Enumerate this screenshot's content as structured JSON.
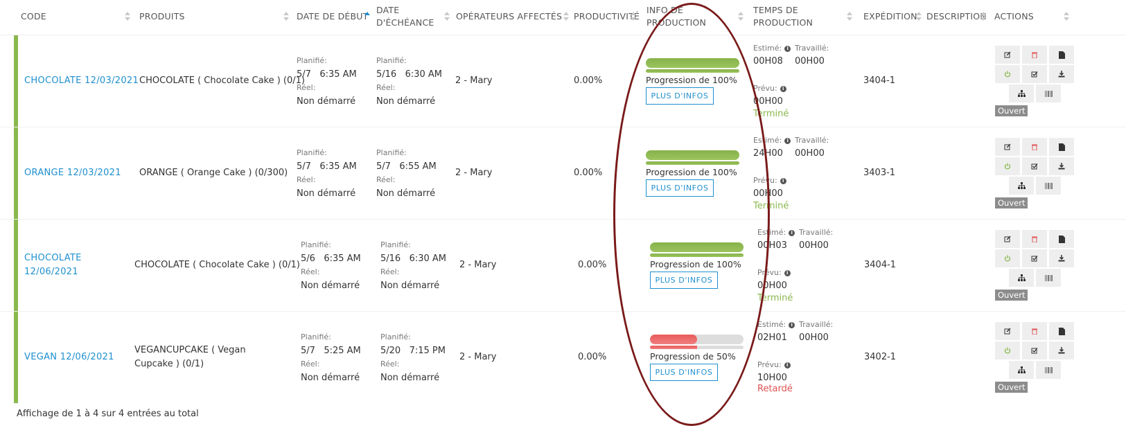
{
  "table": {
    "columns": [
      {
        "label": "CODE",
        "sort": "none"
      },
      {
        "label": "PRODUITS",
        "sort": "none"
      },
      {
        "label": "DATE DE DÉBUT",
        "sort": "asc"
      },
      {
        "label": "DATE D'ÉCHÉANCE",
        "sort": "none"
      },
      {
        "label": "OPÉRATEURS AFFECTÉS",
        "sort": "none"
      },
      {
        "label": "PRODUCTIVITÉ",
        "sort": "none"
      },
      {
        "label": "INFO DE PRODUCTION",
        "sort": "none"
      },
      {
        "label": "TEMPS DE PRODUCTION",
        "sort": "none"
      },
      {
        "label": "EXPÉDITION",
        "sort": "none"
      },
      {
        "label": "DESCRIPTION",
        "sort": "none"
      },
      {
        "label": "ACTIONS",
        "sort": "none"
      }
    ],
    "labels": {
      "planifie": "Planifié:",
      "reel": "Réel:",
      "estime": "Estimé:",
      "travaille": "Travaillé:",
      "prevu": "Prévu:",
      "more_info": "PLUS D'INFOS"
    },
    "rows": [
      {
        "code": "CHOCOLATE 12/03/2021",
        "product": "CHOCOLATE ( Chocolate Cake ) (0/1)",
        "start_planned": "5/7   6:35 AM",
        "start_real": "Non démarré",
        "due_planned": "5/16   6:30 AM",
        "due_real": "Non démarré",
        "operators": "2 - Mary",
        "productivity": "0.00%",
        "progress_text": "Progression de 100%",
        "progress": 1.0,
        "estimated": "00H08",
        "worked": "00H00",
        "planned": "00H00",
        "status": "Terminé",
        "status_kind": "ok",
        "shipping": "3404-1",
        "description": "",
        "state_badge": "Ouvert"
      },
      {
        "code": "ORANGE 12/03/2021",
        "product": "ORANGE ( Orange Cake ) (0/300)",
        "start_planned": "5/7   6:35 AM",
        "start_real": "Non démarré",
        "due_planned": "5/7   6:55 AM",
        "due_real": "Non démarré",
        "operators": "2 - Mary",
        "productivity": "0.00%",
        "progress_text": "Progression de 100%",
        "progress": 1.0,
        "estimated": "24H00",
        "worked": "00H00",
        "planned": "00H00",
        "status": "Terminé",
        "status_kind": "ok",
        "shipping": "3403-1",
        "description": "",
        "state_badge": "Ouvert"
      },
      {
        "code": "CHOCOLATE 12/06/2021",
        "product": "CHOCOLATE ( Chocolate Cake ) (0/1)",
        "start_planned": "5/6   6:35 AM",
        "start_real": "Non démarré",
        "due_planned": "5/16   6:30 AM",
        "due_real": "Non démarré",
        "operators": "2 - Mary",
        "productivity": "0.00%",
        "progress_text": "Progression de 100%",
        "progress": 1.0,
        "estimated": "00H03",
        "worked": "00H00",
        "planned": "00H00",
        "status": "Terminé",
        "status_kind": "ok",
        "shipping": "3404-1",
        "description": "",
        "state_badge": "Ouvert"
      },
      {
        "code": "VEGAN 12/06/2021",
        "product": "VEGANCUPCAKE ( Vegan Cupcake ) (0/1)",
        "start_planned": "5/7   5:25 AM",
        "start_real": "Non démarré",
        "due_planned": "5/20   7:15 PM",
        "due_real": "Non démarré",
        "operators": "2 - Mary",
        "productivity": "0.00%",
        "progress_text": "Progression de 50%",
        "progress": 0.5,
        "estimated": "02H01",
        "worked": "00H00",
        "planned": "10H00",
        "status": "Retardé",
        "status_kind": "late",
        "shipping": "3402-1",
        "description": "",
        "state_badge": "Ouvert"
      }
    ]
  },
  "footer": {
    "text": "Affichage de 1 à 4 sur 4 entrées au total"
  },
  "icons": {
    "edit": "edit-icon",
    "delete": "trash-icon",
    "document": "document-icon",
    "power": "power-icon",
    "check": "check-icon",
    "download": "download-icon",
    "hierarchy": "sitemap-icon",
    "barcode": "barcode-icon"
  },
  "colors": {
    "accent": "#1e8fcf",
    "success": "#8ab84e",
    "danger": "#e05252",
    "annotation": "#7a1a1a"
  }
}
